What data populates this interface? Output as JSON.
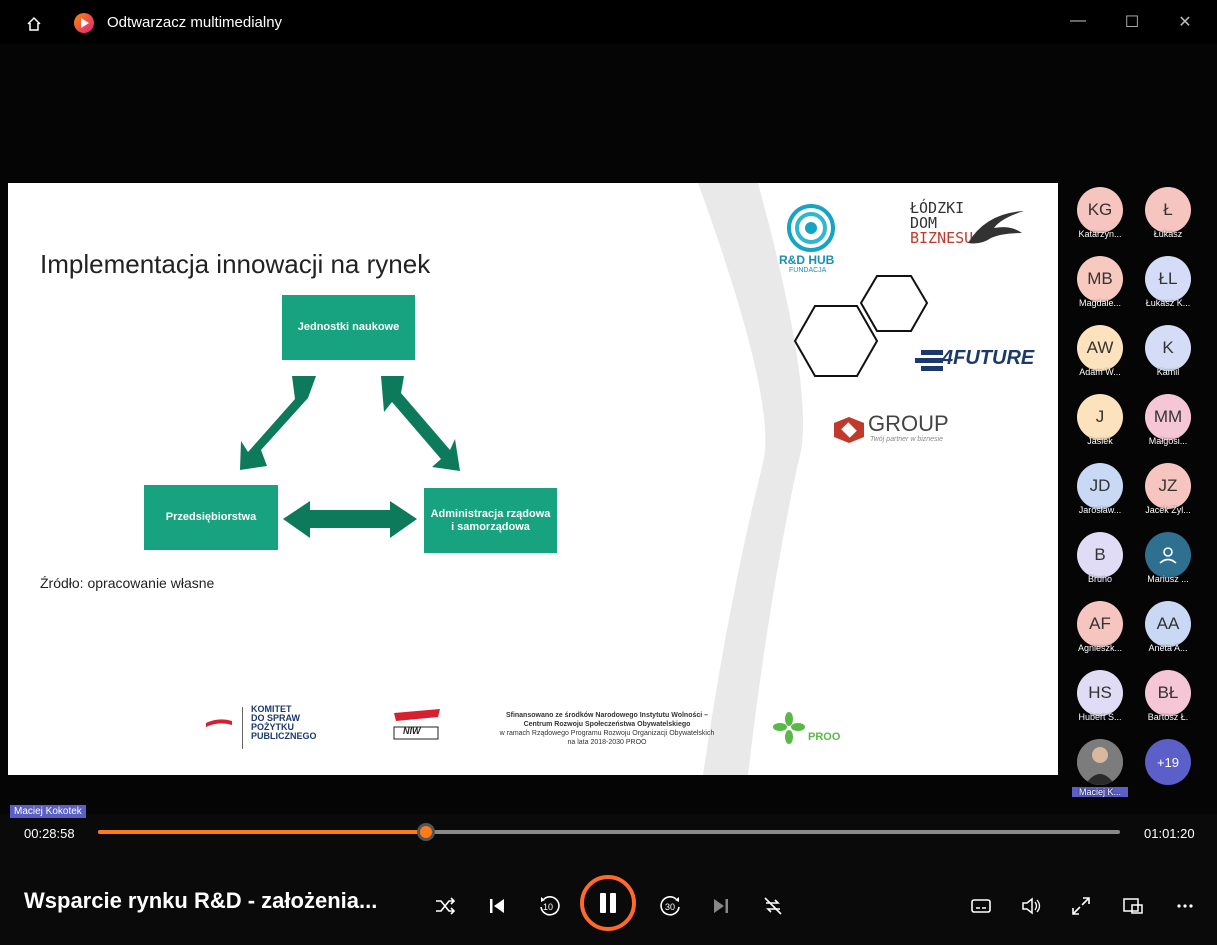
{
  "window": {
    "title": "Odtwarzacz multimedialny",
    "controls": {
      "minimize": "—",
      "maximize": "☐",
      "close": "✕"
    }
  },
  "slide": {
    "title": "Implementacja innowacji na rynek",
    "boxes": {
      "top": "Jednostki naukowe",
      "left": "Przedsiębiorstwa",
      "right_line1": "Administracja rządowa",
      "right_line2": "i samorządowa"
    },
    "source": "Źródło: opracowanie własne",
    "logos": {
      "rd_hub": "R&D HUB",
      "rd_hub_sub": "FUNDACJA",
      "lodzki_1": "ŁÓDZKI",
      "lodzki_2": "DOM",
      "lodzki_3": "BIZNESU",
      "future": "4FUTURE",
      "group": "GROUP",
      "group_sub": "Twój partner w biznesie",
      "komitet_1": "KOMITET",
      "komitet_2": "DO SPRAW",
      "komitet_3": "POŻYTKU",
      "komitet_4": "PUBLICZNEGO",
      "niw": "NIW",
      "proo": "PROO"
    },
    "funding_line1": "Sfinansowano ze środków Narodowego Instytutu Wolności –",
    "funding_line2": "Centrum Rozwoju Społeczeństwa Obywatelskiego",
    "funding_line3": "w ramach Rządowego Programu Rozwoju Organizacji Obywatelskich",
    "funding_line4": "na lata 2018-2030 PROO"
  },
  "participants": [
    {
      "initials": "KG",
      "name": "Katarzyn...",
      "color": "#f6c5c0"
    },
    {
      "initials": "Ł",
      "name": "Łukasz",
      "color": "#f6c5c0"
    },
    {
      "initials": "MB",
      "name": "Magdale...",
      "color": "#f7c9bf"
    },
    {
      "initials": "ŁL",
      "name": "Łukasz K...",
      "color": "#d5dcf7"
    },
    {
      "initials": "AW",
      "name": "Adam W...",
      "color": "#fde3bd"
    },
    {
      "initials": "K",
      "name": "Kamil",
      "color": "#d5dcf7"
    },
    {
      "initials": "J",
      "name": "Jasiek",
      "color": "#fde3bd"
    },
    {
      "initials": "MM",
      "name": "Małgosi...",
      "color": "#f5c6d6"
    },
    {
      "initials": "JD",
      "name": "Jarosław...",
      "color": "#c9d9f5"
    },
    {
      "initials": "JZ",
      "name": "Jacek Zyl...",
      "color": "#f6c5c0"
    },
    {
      "initials": "B",
      "name": "Bruno",
      "color": "#e1dcf5"
    },
    {
      "initials": "",
      "name": "Mariusz ...",
      "color": "#2f6f8f"
    },
    {
      "initials": "AF",
      "name": "Agnieszk...",
      "color": "#f6c5c0"
    },
    {
      "initials": "AA",
      "name": "Aneta A...",
      "color": "#c9d9f5"
    },
    {
      "initials": "HS",
      "name": "Hubert S...",
      "color": "#e1dcf5"
    },
    {
      "initials": "BŁ",
      "name": "Bartosz Ł.",
      "color": "#f5c6d6"
    },
    {
      "initials": "",
      "name": "Maciej K...",
      "color": "#6b6b6b"
    },
    {
      "initials": "+19",
      "name": "",
      "color": "#5b5fc7"
    }
  ],
  "speaker_label": "Maciej Kokotek",
  "player": {
    "current_time": "00:28:58",
    "total_time": "01:01:20",
    "progress": 0.3205,
    "media_title": "Wsparcie rynku R&D - założenia...",
    "skip_back": "10",
    "skip_forward": "30"
  },
  "colors": {
    "accent": "#ff7a1a",
    "slide_green": "#17a37f",
    "arrow_green": "#0e7a5c"
  }
}
